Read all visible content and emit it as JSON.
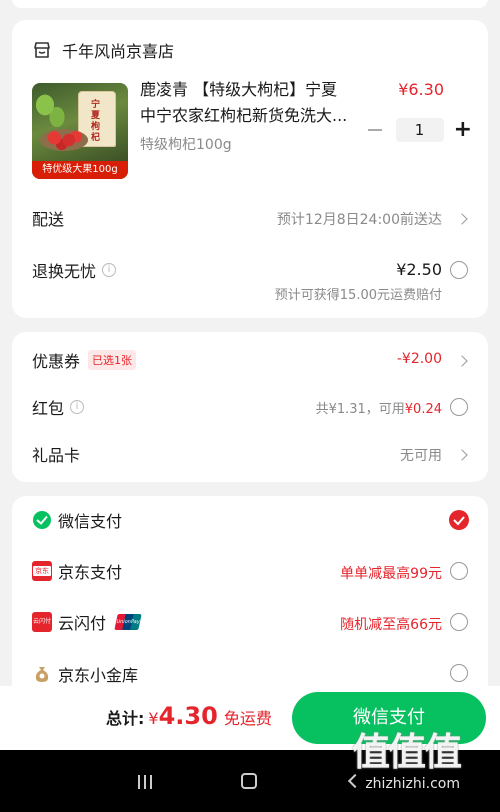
{
  "store": {
    "name": "千年风尚京喜店"
  },
  "product": {
    "title_line1": "鹿凌青 【特级大枸杞】宁夏",
    "title_line2": "中宁农家红枸杞新货免洗大...",
    "price": "¥6.30",
    "spec": "特级枸杞100g",
    "quantity": "1",
    "image_badge": "特优级大果100g",
    "bag_text": "宁夏枸杞"
  },
  "delivery": {
    "label": "配送",
    "value": "预计12月8日24:00前送达"
  },
  "return": {
    "label": "退换无忧",
    "info": "i",
    "price": "¥2.50",
    "note": "预计可获得15.00元运费赔付"
  },
  "coupon": {
    "label": "优惠券",
    "badge": "已选1张",
    "value": "-¥2.00"
  },
  "hongbao": {
    "label": "红包",
    "info": "i",
    "value_prefix": "共¥1.31，可用",
    "value_amount": "¥0.24"
  },
  "giftcard": {
    "label": "礼品卡",
    "value": "无可用"
  },
  "payments": [
    {
      "name": "微信支付",
      "promo": ""
    },
    {
      "name": "京东支付",
      "promo": "单单减最高99元"
    },
    {
      "name": "云闪付",
      "promo": "随机减至高66元"
    },
    {
      "name": "京东小金库",
      "promo": ""
    }
  ],
  "icons": {
    "jdpay": "京东",
    "unionpay": "云闪付",
    "quickpass": "UnionPay"
  },
  "footer": {
    "total_label": "总计:",
    "currency": "¥",
    "total": "4.30",
    "shipping": "免运费",
    "pay_button": "微信支付"
  },
  "watermark": {
    "text": "值值值",
    "url": "zhizhizhi.com"
  },
  "colors": {
    "accent_green": "#07c160",
    "price_red": "#e5252c"
  }
}
